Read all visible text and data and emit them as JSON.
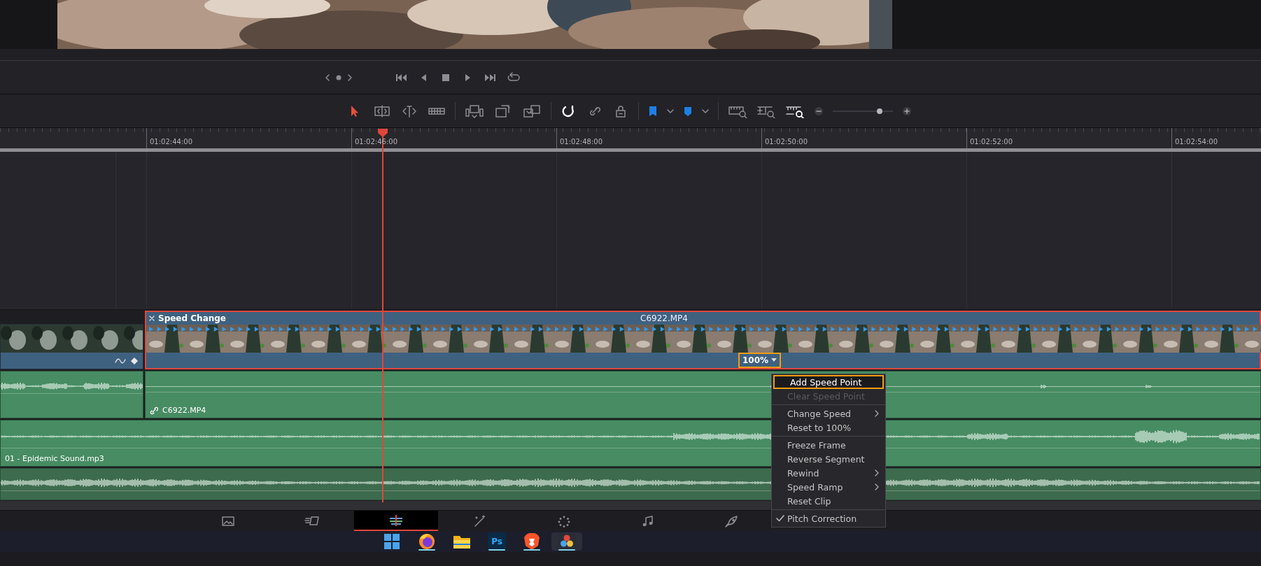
{
  "toolbar": {
    "edit_tools": [
      {
        "selected": true
      },
      {
        "selected": false
      },
      {
        "selected": false
      },
      {
        "selected": false
      }
    ],
    "snapping": {
      "on": true
    },
    "zoom": {
      "level": 0.78
    }
  },
  "ruler": {
    "timecodes": [
      "01:02:44:00",
      "01:02:46:00",
      "01:02:48:00",
      "01:02:50:00",
      "01:02:52:00",
      "01:02:54:00"
    ]
  },
  "video_track": {
    "left_clip": {
      "selected": false
    },
    "clip": {
      "selected": true,
      "effect": "Speed Change",
      "name": "C6922.MP4",
      "speed": "100%"
    }
  },
  "audio_tracks": [
    {
      "color": "#478c63",
      "clips": [
        {
          "kind": "tail"
        },
        {
          "kind": "main",
          "label": "C6922.MP4",
          "linked": true
        }
      ]
    },
    {
      "color": "#478c63",
      "clips": [
        {
          "kind": "main",
          "label": "01 - Epidemic Sound.mp3",
          "linked": false
        }
      ]
    },
    {
      "color": "#3d6b4e",
      "clips": [
        {
          "kind": "main"
        }
      ]
    }
  ],
  "context_menu": {
    "items": [
      {
        "kind": "item",
        "label": "Add Speed Point",
        "selected": true,
        "disabled": false,
        "submenu": false,
        "checked": false
      },
      {
        "kind": "item",
        "label": "Clear Speed Point",
        "selected": false,
        "disabled": true,
        "submenu": false,
        "checked": false
      },
      {
        "kind": "separator"
      },
      {
        "kind": "item",
        "label": "Change Speed",
        "selected": false,
        "disabled": false,
        "submenu": true,
        "checked": false
      },
      {
        "kind": "item",
        "label": "Reset to 100%",
        "selected": false,
        "disabled": false,
        "submenu": false,
        "checked": false
      },
      {
        "kind": "separator"
      },
      {
        "kind": "item",
        "label": "Freeze Frame",
        "selected": false,
        "disabled": false,
        "submenu": false,
        "checked": false
      },
      {
        "kind": "item",
        "label": "Reverse Segment",
        "selected": false,
        "disabled": false,
        "submenu": false,
        "checked": false
      },
      {
        "kind": "item",
        "label": "Rewind",
        "selected": false,
        "disabled": false,
        "submenu": true,
        "checked": false
      },
      {
        "kind": "item",
        "label": "Speed Ramp",
        "selected": false,
        "disabled": false,
        "submenu": true,
        "checked": false
      },
      {
        "kind": "item",
        "label": "Reset Clip",
        "selected": false,
        "disabled": false,
        "submenu": false,
        "checked": false
      },
      {
        "kind": "separator"
      },
      {
        "kind": "item",
        "label": "Pitch Correction",
        "selected": false,
        "disabled": false,
        "submenu": false,
        "checked": true
      }
    ]
  },
  "page_tabs": [
    {
      "selected": false
    },
    {
      "selected": false
    },
    {
      "selected": true
    },
    {
      "selected": false
    },
    {
      "selected": false
    },
    {
      "selected": false
    },
    {
      "selected": false
    }
  ],
  "taskbar": [
    {
      "kind": "start",
      "running": false,
      "selected": false
    },
    {
      "kind": "browser",
      "running": true,
      "selected": false
    },
    {
      "kind": "folder",
      "running": false,
      "selected": false
    },
    {
      "kind": "photoshop",
      "label": "Ps",
      "running": true,
      "selected": false
    },
    {
      "kind": "lion",
      "running": true,
      "selected": false
    },
    {
      "kind": "resolve",
      "running": true,
      "selected": true
    }
  ]
}
